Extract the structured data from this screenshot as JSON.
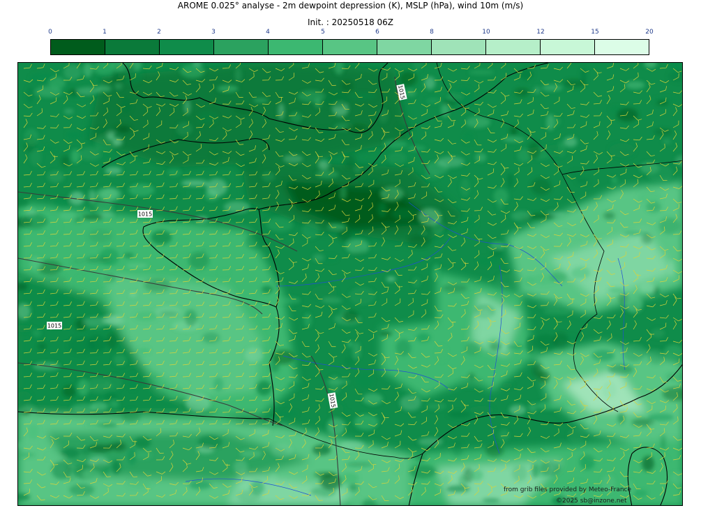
{
  "header": {
    "title": "AROME 0.025° analyse - 2m dewpoint depression (K), MSLP (hPa), wind 10m (m/s)",
    "init": "Init. : 20250518 06Z"
  },
  "legend": {
    "ticks": [
      "0",
      "1",
      "2",
      "3",
      "4",
      "5",
      "6",
      "8",
      "10",
      "12",
      "15",
      "20"
    ],
    "colors": [
      "#005c1c",
      "#0a7a3a",
      "#0f8c4a",
      "#2ba25f",
      "#3cb871",
      "#58c584",
      "#7fd6a2",
      "#9fe3b8",
      "#b6efc9",
      "#c8f7d7",
      "#dcfde7"
    ]
  },
  "map": {
    "isobar_labels": [
      "1015",
      "1015",
      "1015",
      "1015"
    ],
    "colors": {
      "coast": "#000000",
      "river": "#1f4fd1",
      "isobar": "#3a3a3a",
      "barb": "#d9d43a"
    }
  },
  "credits": {
    "source": "from grib files provided by Meteo-France",
    "copyright": "©2025 sb@inzone.net"
  }
}
